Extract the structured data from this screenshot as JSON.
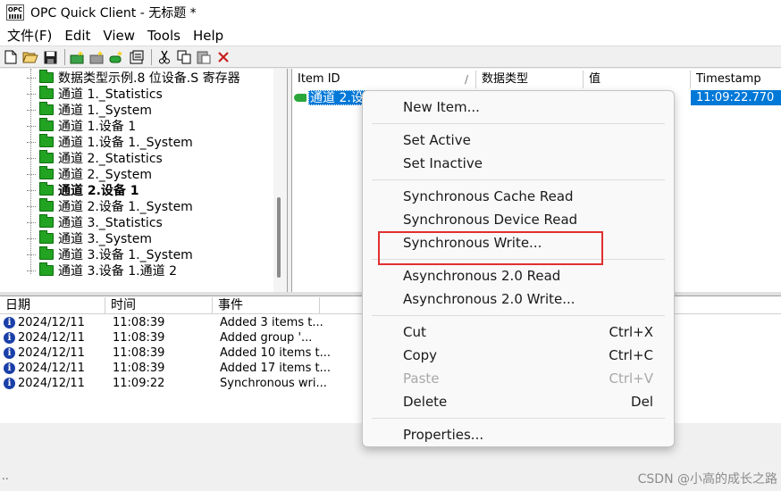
{
  "window": {
    "title": "OPC Quick Client - 无标题 *",
    "app_icon_text": "OPC"
  },
  "menubar": [
    "文件(F)",
    "Edit",
    "View",
    "Tools",
    "Help"
  ],
  "toolbar": {
    "buttons": [
      "new-file-icon",
      "open-file-icon",
      "save-icon",
      "new-server-icon",
      "new-group-icon",
      "new-item-icon",
      "properties-icon",
      "cut-icon",
      "copy-icon",
      "paste-icon",
      "delete-icon"
    ]
  },
  "tree": {
    "items": [
      {
        "label": "数据类型示例.8 位设备.S 寄存器",
        "bold": false
      },
      {
        "label": "通道 1._Statistics",
        "bold": false
      },
      {
        "label": "通道 1._System",
        "bold": false
      },
      {
        "label": "通道 1.设备 1",
        "bold": false
      },
      {
        "label": "通道 1.设备 1._System",
        "bold": false
      },
      {
        "label": "通道 2._Statistics",
        "bold": false
      },
      {
        "label": "通道 2._System",
        "bold": false
      },
      {
        "label": "通道 2.设备 1",
        "bold": true
      },
      {
        "label": "通道 2.设备 1._System",
        "bold": false
      },
      {
        "label": "通道 3._Statistics",
        "bold": false
      },
      {
        "label": "通道 3._System",
        "bold": false
      },
      {
        "label": "通道 3.设备 1._System",
        "bold": false
      },
      {
        "label": "通道 3.设备 1.通道 2",
        "bold": false
      }
    ]
  },
  "items_list": {
    "columns": [
      "Item ID",
      "数据类型",
      "值",
      "Timestamp"
    ],
    "sort_indicator": "/",
    "rows": [
      {
        "item_id": "通道 2.设",
        "timestamp": "11:09:22.770"
      }
    ]
  },
  "event_log": {
    "columns": [
      "日期",
      "时间",
      "事件"
    ],
    "rows": [
      {
        "date": "2024/12/11",
        "time": "11:08:39",
        "event": "Added 3 items t..."
      },
      {
        "date": "2024/12/11",
        "time": "11:08:39",
        "event": "Added group '..."
      },
      {
        "date": "2024/12/11",
        "time": "11:08:39",
        "event": "Added 10 items t..."
      },
      {
        "date": "2024/12/11",
        "time": "11:08:39",
        "event": "Added 17 items t..."
      },
      {
        "date": "2024/12/11",
        "time": "11:09:22",
        "event": "Synchronous wri..."
      }
    ]
  },
  "context_menu": {
    "items": [
      {
        "label": "New Item...",
        "shortcut": "",
        "disabled": false
      },
      {
        "label": "Set Active",
        "shortcut": "",
        "disabled": false
      },
      {
        "label": "Set Inactive",
        "shortcut": "",
        "disabled": false
      },
      {
        "label": "Synchronous Cache Read",
        "shortcut": "",
        "disabled": false
      },
      {
        "label": "Synchronous Device Read",
        "shortcut": "",
        "disabled": false
      },
      {
        "label": "Synchronous Write...",
        "shortcut": "",
        "disabled": false
      },
      {
        "label": "Asynchronous 2.0 Read",
        "shortcut": "",
        "disabled": false
      },
      {
        "label": "Asynchronous 2.0 Write...",
        "shortcut": "",
        "disabled": false
      },
      {
        "label": "Cut",
        "shortcut": "Ctrl+X",
        "disabled": false
      },
      {
        "label": "Copy",
        "shortcut": "Ctrl+C",
        "disabled": false
      },
      {
        "label": "Paste",
        "shortcut": "Ctrl+V",
        "disabled": true
      },
      {
        "label": "Delete",
        "shortcut": "Del",
        "disabled": false
      },
      {
        "label": "Properties...",
        "shortcut": "",
        "disabled": false
      }
    ]
  },
  "status": {
    "dots": "..",
    "watermark": "CSDN @小高的成长之路"
  },
  "colors": {
    "selection": "#0078d7",
    "folder": "#22a322",
    "highlight": "#e03030",
    "info": "#1a3fa8"
  }
}
